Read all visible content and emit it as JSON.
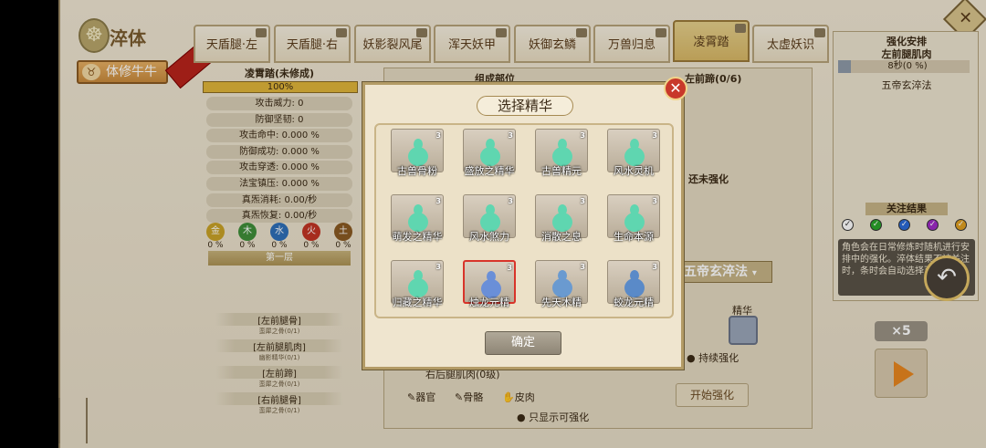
{
  "header": {
    "title": "淬体",
    "sub_button": "体修牛牛"
  },
  "tabs": [
    {
      "label": "天盾腿·左",
      "selected": false
    },
    {
      "label": "天盾腿·右",
      "selected": false
    },
    {
      "label": "妖影裂风尾",
      "selected": false
    },
    {
      "label": "浑天妖甲",
      "selected": false
    },
    {
      "label": "妖御玄鳞",
      "selected": false
    },
    {
      "label": "万兽归息",
      "selected": false
    },
    {
      "label": "凌霄踏",
      "selected": true
    },
    {
      "label": "太虚妖识",
      "selected": false
    }
  ],
  "stats": {
    "title": "凌霄踏(未修成)",
    "progress": "100%",
    "rows": [
      "攻击威力: 0",
      "防御坚韧: 0",
      "攻击命中: 0.000 %",
      "防御成功: 0.000 %",
      "攻击穿透: 0.000 %",
      "法宝镇压: 0.000 %",
      "真炁消耗: 0.00/秒",
      "真炁恢复: 0.00/秒"
    ],
    "elements": [
      {
        "name": "金",
        "value": "0 %",
        "color": "#c9a227"
      },
      {
        "name": "木",
        "value": "0 %",
        "color": "#3f8f3a"
      },
      {
        "name": "水",
        "value": "0 %",
        "color": "#2e6fb8"
      },
      {
        "name": "火",
        "value": "0 %",
        "color": "#c23424"
      },
      {
        "name": "土",
        "value": "0 %",
        "color": "#8a5a22"
      }
    ],
    "layer": "第一层"
  },
  "materials": [
    {
      "name": "[左前腿骨]",
      "sub": "蛮犀之骨(0/1)"
    },
    {
      "name": "[左前腿肌肉]",
      "sub": "幽影精华(0/1)"
    },
    {
      "name": "[左前蹄]",
      "sub": "蛮犀之骨(0/1)"
    },
    {
      "name": "[右前腿骨]",
      "sub": "蛮犀之骨(0/1)"
    }
  ],
  "middle": {
    "heading": "组成部位",
    "part_heading": "左前蹄(0/6)",
    "status": "还未强化",
    "method": "五帝玄淬法",
    "essence_label": "精华",
    "continuous": "持续强化",
    "visible_item": "右后腿肌肉(0级)",
    "filters": [
      "器官",
      "骨骼",
      "皮肉"
    ],
    "only_strengthenable": "只显示可强化",
    "start": "开始强化"
  },
  "right": {
    "title": "强化安排",
    "target": "左前腿肌肉",
    "timer": "8秒(0 %)",
    "method": "五帝玄淬法",
    "focus_title": "关注结果",
    "checks": [
      "#ffffff",
      "#2aa52a",
      "#2a6ad8",
      "#a02ac8",
      "#e0a020"
    ],
    "note": "角色会在日常修炼时随机进行安排中的强化。淬体结果不被关注时，条时会自动选择百...",
    "multiplier": "×5"
  },
  "dialog": {
    "title": "选择精华",
    "confirm": "确定",
    "items": [
      {
        "name": "古兽骨粉",
        "count": "3",
        "color": "#5fd6b0",
        "selected": false
      },
      {
        "name": "盛放之精华",
        "count": "3",
        "color": "#5fd6b0",
        "selected": false
      },
      {
        "name": "古兽精元",
        "count": "3",
        "color": "#5fd6b0",
        "selected": false
      },
      {
        "name": "风水灵机",
        "count": "3",
        "color": "#5fd6b0",
        "selected": false
      },
      {
        "name": "萌发之精华",
        "count": "3",
        "color": "#5fd6b0",
        "selected": false
      },
      {
        "name": "风水煞力",
        "count": "3",
        "color": "#5fd6b0",
        "selected": false
      },
      {
        "name": "消散之息",
        "count": "3",
        "color": "#5fd6b0",
        "selected": false
      },
      {
        "name": "生命本源",
        "count": "3",
        "color": "#5fd6b0",
        "selected": false
      },
      {
        "name": "归藏之精华",
        "count": "3",
        "color": "#5fd6b0",
        "selected": false
      },
      {
        "name": "烛龙元精",
        "count": "3",
        "color": "#6a8fd8",
        "selected": true
      },
      {
        "name": "先天木精",
        "count": "3",
        "color": "#6a9ad0",
        "selected": false
      },
      {
        "name": "蛟龙元精",
        "count": "3",
        "color": "#5a8ac8",
        "selected": false
      }
    ]
  }
}
